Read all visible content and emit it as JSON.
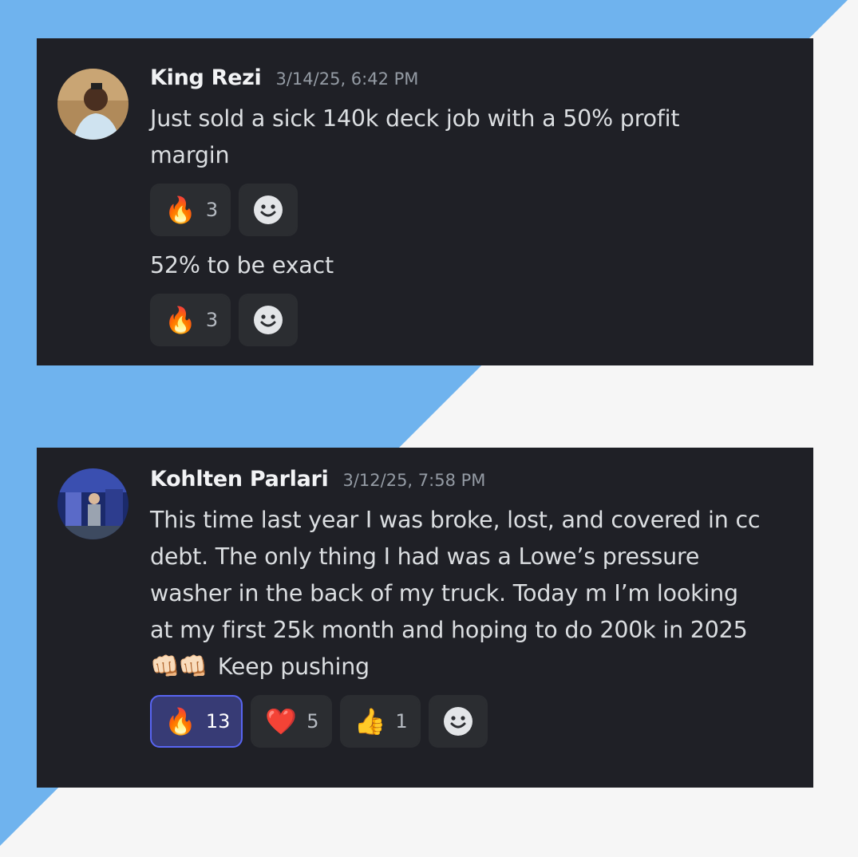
{
  "messages": [
    {
      "author": "King Rezi",
      "timestamp": "3/14/25, 6:42 PM",
      "posts": [
        {
          "lines": [
            "Just sold a sick 140k deck job with a 50% profit",
            "margin"
          ],
          "reactions": [
            {
              "emoji": "🔥",
              "icon": "fire-emoji",
              "count": "3",
              "active": false
            }
          ]
        },
        {
          "lines": [
            "52% to be exact"
          ],
          "reactions": [
            {
              "emoji": "🔥",
              "icon": "fire-emoji",
              "count": "3",
              "active": false
            }
          ]
        }
      ]
    },
    {
      "author": "Kohlten Parlari",
      "timestamp": "3/12/25, 7:58 PM",
      "posts": [
        {
          "lines": [
            "This time last year I was broke, lost, and covered in cc",
            "debt. The only thing I had was a Lowe’s pressure",
            "washer in the back of my truck. Today m I’m looking",
            "at my first 25k month and hoping to do 200k in 2025"
          ],
          "last_line_emoji": "👊🏻👊🏻",
          "last_line_text": "Keep pushing",
          "reactions": [
            {
              "emoji": "🔥",
              "icon": "fire-emoji",
              "count": "13",
              "active": true
            },
            {
              "emoji": "❤️",
              "icon": "heart-emoji",
              "count": "5",
              "active": false
            },
            {
              "emoji": "👍",
              "icon": "thumbs-up-emoji",
              "count": "1",
              "active": false
            }
          ]
        }
      ]
    }
  ],
  "colors": {
    "background_blue": "#6fb3ee",
    "background_light": "#f6f6f6",
    "card": "#1f2026",
    "reaction_bg": "#2b2d31",
    "reaction_active_bg": "#373b75",
    "reaction_active_border": "#5865f2"
  },
  "icons": {
    "add_reaction": "smile-add-reaction-icon"
  }
}
